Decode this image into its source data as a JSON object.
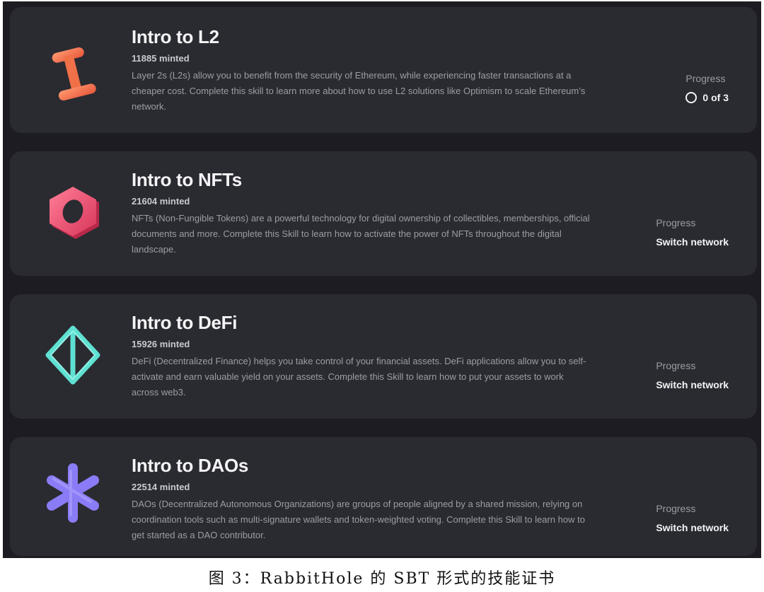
{
  "skills": [
    {
      "title": "Intro to L2",
      "minted": "11885 minted",
      "description": "Layer 2s (L2s) allow you to benefit from the security of Ethereum, while experiencing faster transactions at a cheaper cost. Complete this skill to learn more about how to use L2 solutions like Optimism to scale Ethereum’s network.",
      "progress_label": "Progress",
      "progress_value": "0 of 3",
      "icon": "l2-beam-icon",
      "icon_color": "#ff7a55"
    },
    {
      "title": "Intro to NFTs",
      "minted": "21604 minted",
      "description": "NFTs (Non-Fungible Tokens) are a powerful technology for digital ownership of collectibles, memberships, official documents and more. Complete this Skill to learn how to activate the power of NFTs throughout the digital landscape.",
      "progress_label": "Progress",
      "progress_value": "Switch network",
      "icon": "nft-hex-nut-icon",
      "icon_color": "#f0587a"
    },
    {
      "title": "Intro to DeFi",
      "minted": "15926 minted",
      "description": "DeFi (Decentralized Finance) helps you take control of your financial assets. DeFi applications allow you to self-activate and earn valuable yield on your assets. Complete this Skill to learn how to put your assets to work across web3.",
      "progress_label": "Progress",
      "progress_value": "Switch network",
      "icon": "defi-octahedron-icon",
      "icon_color": "#5fe0d2"
    },
    {
      "title": "Intro to DAOs",
      "minted": "22514 minted",
      "description": "DAOs (Decentralized Autonomous Organizations) are groups of people aligned by a shared mission, relying on coordination tools such as multi-signature wallets and token-weighted voting. Complete this Skill to learn how to get started as a DAO contributor.",
      "progress_label": "Progress",
      "progress_value": "Switch network",
      "icon": "dao-asterisk-icon",
      "icon_color": "#8a7cf6"
    }
  ],
  "caption": "图 3：RabbitHole 的 SBT 形式的技能证书",
  "colors": {
    "background": "#1c1c22",
    "card": "#2a2b31",
    "title_text": "#f4f4f6",
    "body_text": "#9c9ca6"
  }
}
